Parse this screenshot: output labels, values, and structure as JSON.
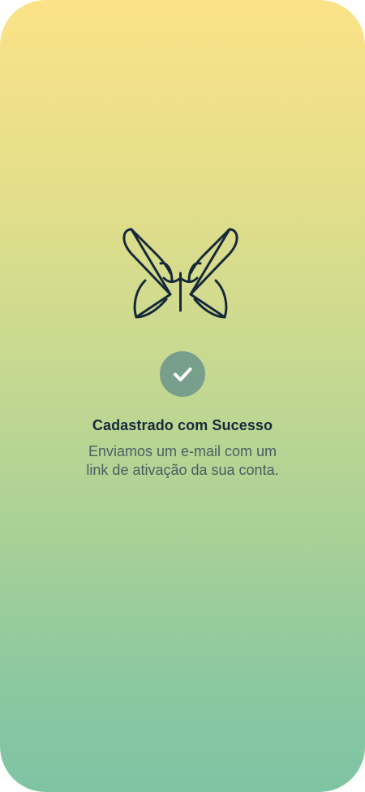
{
  "screen": {
    "logo_icon": "butterfly-logo-icon",
    "status_icon": "check-icon",
    "title": "Cadastrado com Sucesso",
    "message_lines": [
      "Enviamos um e-mail com um",
      "link de ativação da sua conta."
    ]
  },
  "colors": {
    "gradient_top": "#FBE288",
    "gradient_bottom": "#7FC4A4",
    "logo_stroke": "#16293A",
    "badge": "#789F8C",
    "title": "#16293A",
    "message": "#4A5E62"
  }
}
